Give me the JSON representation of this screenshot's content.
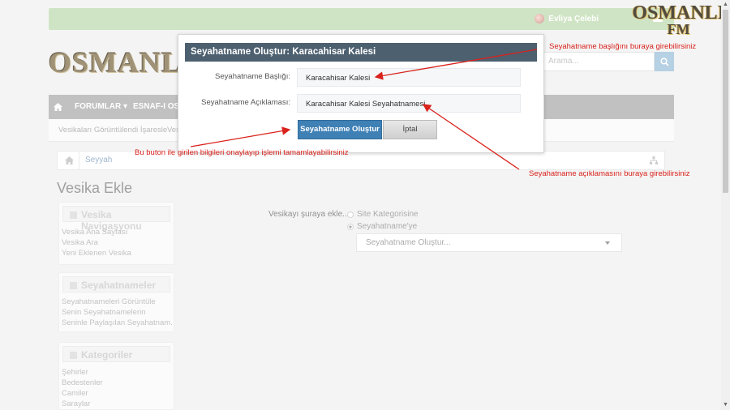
{
  "topbar": {
    "username": "Evliya Çelebi"
  },
  "site_logo": "OSMANLI",
  "watermark": {
    "line1": "OSMANLI",
    "line2": "FM"
  },
  "search": {
    "placeholder": "Arama..."
  },
  "nav": {
    "items": [
      "FORUMLAR",
      "ESNAF-I OSMA"
    ]
  },
  "subnav": {
    "items": [
      "Vesikaları Görüntülendi İşaresle",
      "Ves"
    ]
  },
  "breadcrumb": {
    "item": "Seyyah"
  },
  "page_title": "Vesika Ekle",
  "sidebar": {
    "blocks": [
      {
        "title": "Vesika Navigasyonu",
        "links": [
          "Vesika Ana Sayfası",
          "Vesika Ara",
          "Yeni Eklenen Vesika"
        ]
      },
      {
        "title": "Seyahatnameler",
        "links": [
          "Seyahatnameleri Görüntüle",
          "Senin Seyahatnamelerin",
          "Seninle Paylaşılan Seyahatnam..."
        ]
      },
      {
        "title": "Kategoriler",
        "links": [
          "Şehirler",
          "Bedestenler",
          "Camiler",
          "Saraylar"
        ]
      }
    ]
  },
  "form": {
    "label": "Vesikayı şuraya ekle...",
    "options": [
      "Site Kategorisine",
      "Seyahatname'ye"
    ],
    "selected_option": 1,
    "select_value": "Seyahatname Oluştur..."
  },
  "modal": {
    "title": "Seyahatname Oluştur: Karacahisar Kalesi",
    "title_label": "Seyahatname Başlığı:",
    "title_value": "Karacahisar Kalesi",
    "desc_label": "Seyahatname Açıklaması:",
    "desc_value": "Karacahisar Kalesi Seyahatnamesi",
    "create_button": "Seyahatname Oluştur",
    "cancel_button": "İptal"
  },
  "annotations": {
    "title_hint": "Seyahatname başlığını buraya girebilirsiniz",
    "button_hint": "Bu buton ile girilen bilgileri onaylayıp işlemi tamamlayabilirsiniz",
    "desc_hint": "Seyahatname açıklamasını buraya girebilirsiniz"
  },
  "colors": {
    "annotation": "#d9221c",
    "modal_header": "#4d6070",
    "primary_button": "#3f80b5",
    "topbar": "#c5dfb8"
  }
}
